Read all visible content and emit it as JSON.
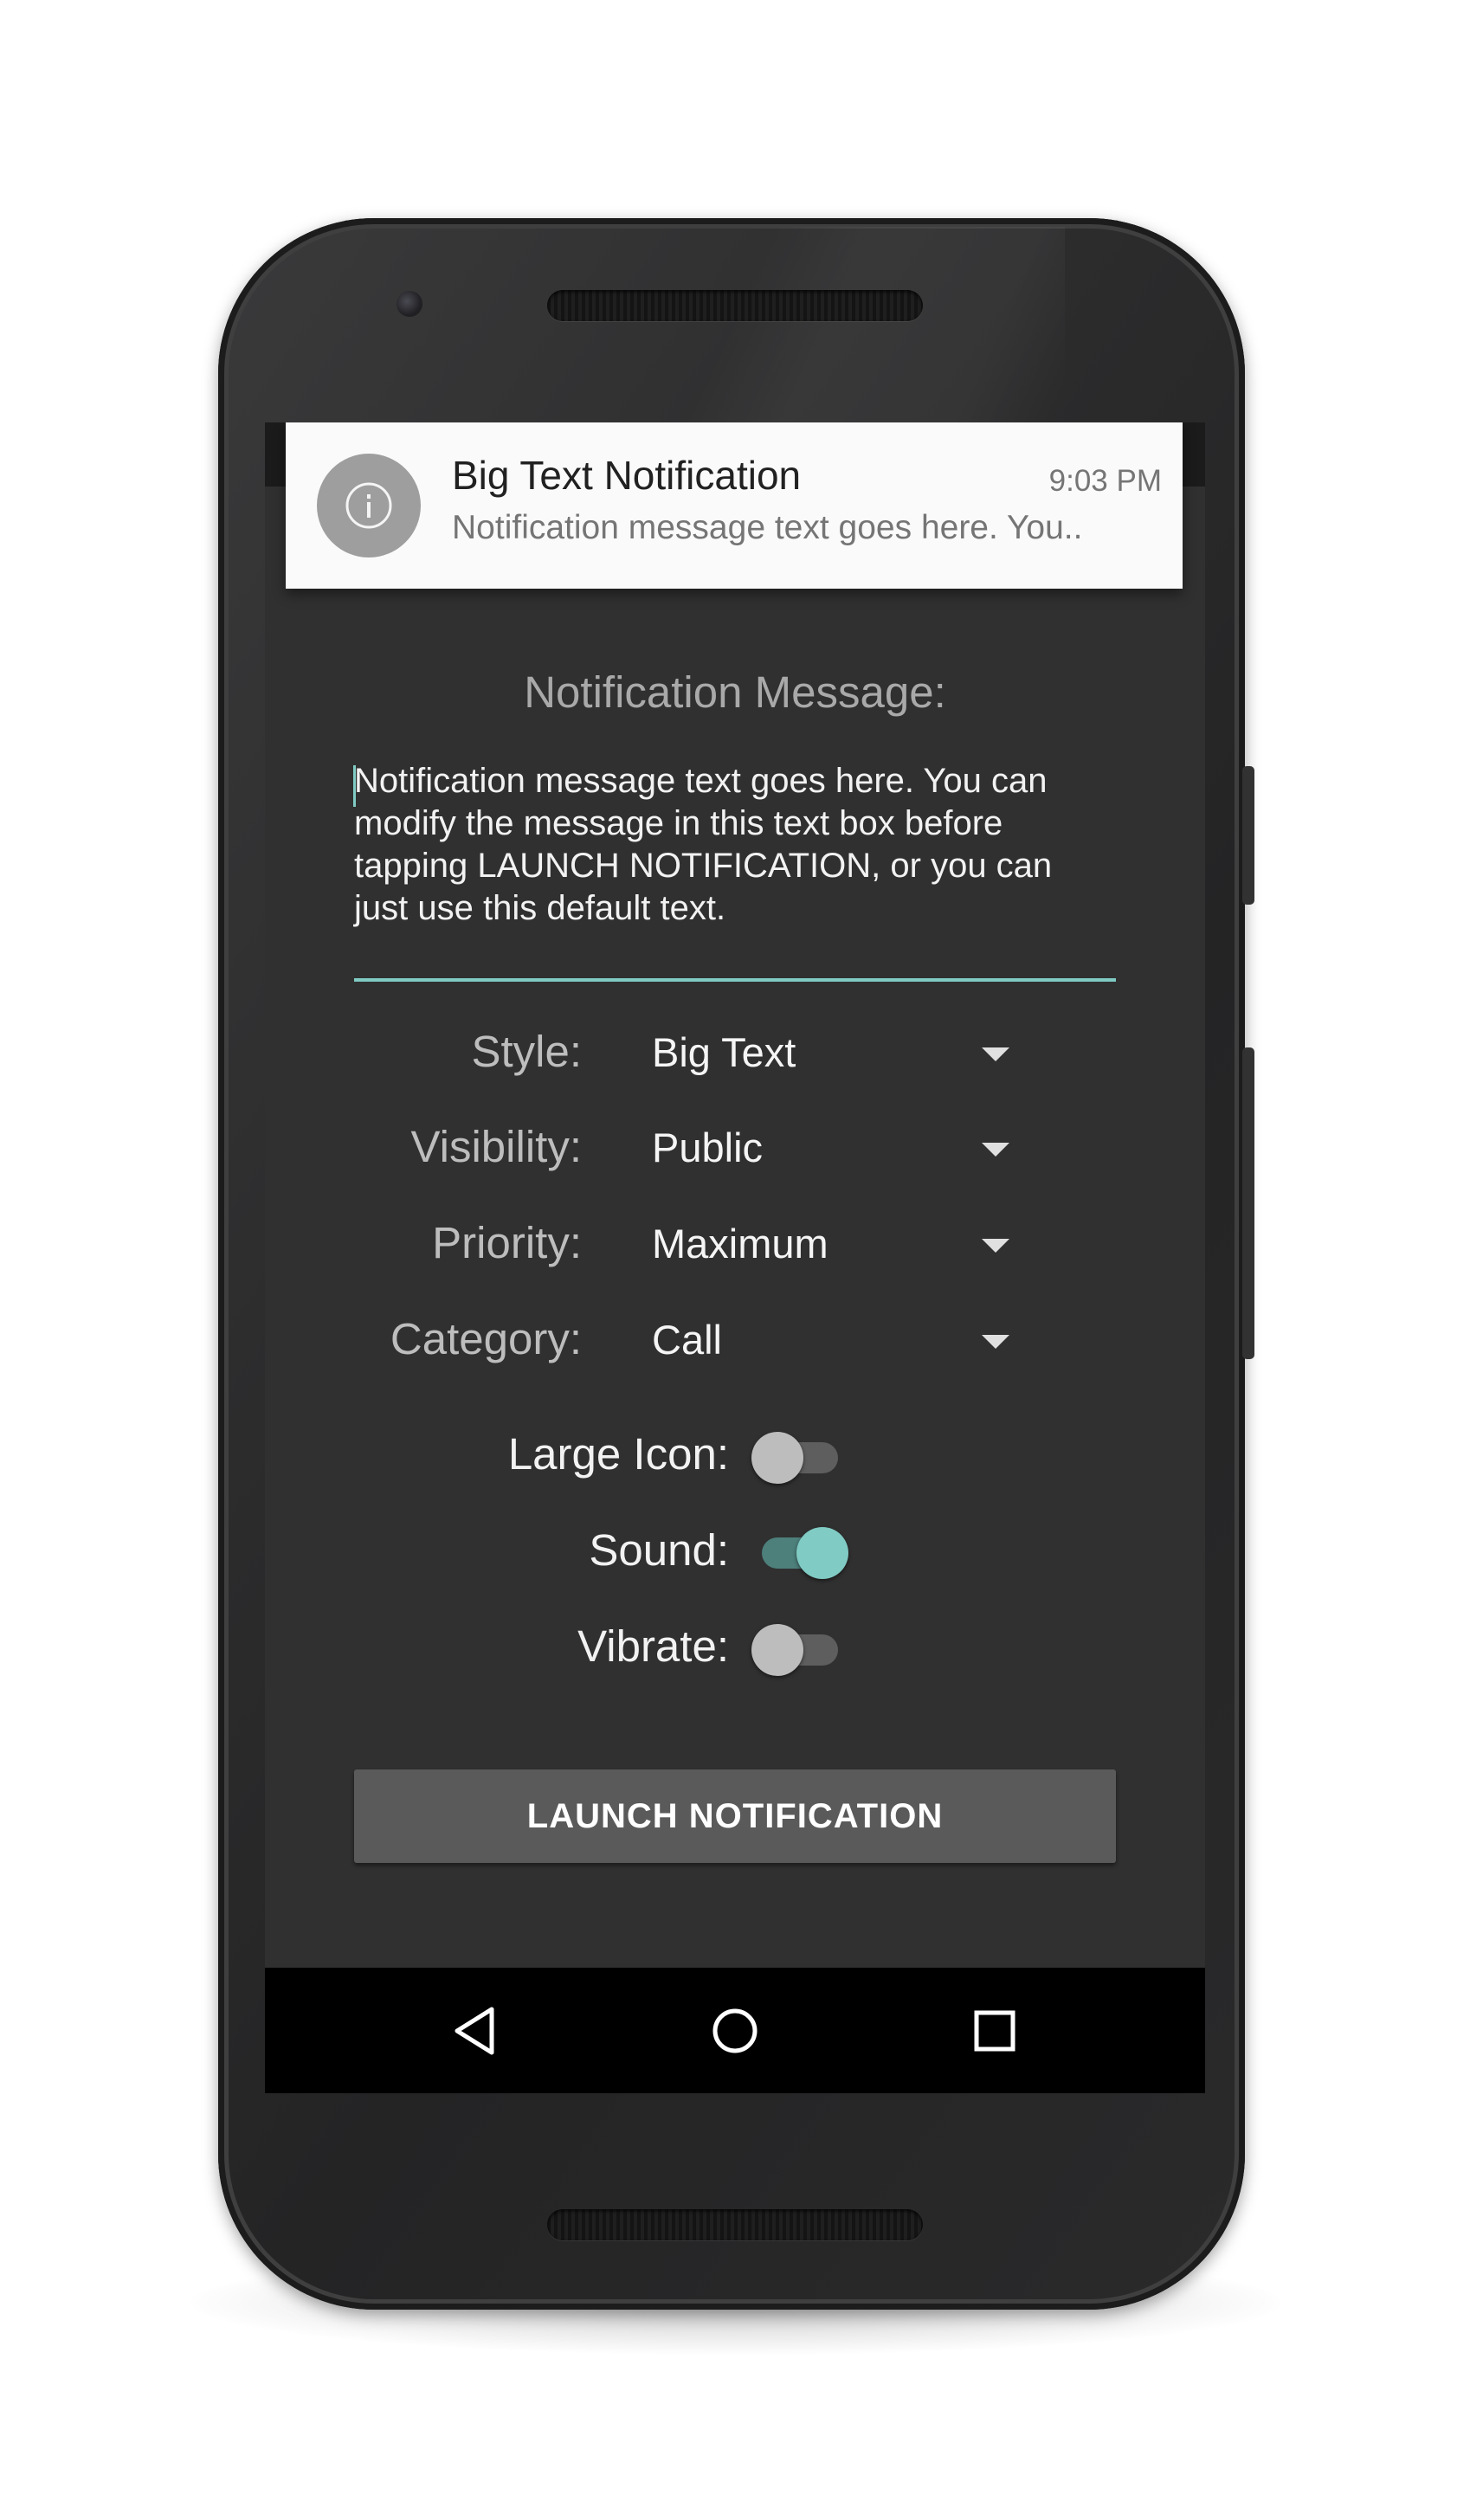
{
  "notification": {
    "icon": "info-icon",
    "title": "Big Text Notification",
    "time": "9:03 PM",
    "text": "Notification message text goes here. You.."
  },
  "message": {
    "heading": "Notification Message:",
    "text": "Notification message text goes here. You can\nmodify the message in this text box before\ntapping LAUNCH NOTIFICATION, or you can\njust use this default text."
  },
  "fields": {
    "style": {
      "label": "Style:",
      "value": "Big Text"
    },
    "visibility": {
      "label": "Visibility:",
      "value": "Public"
    },
    "priority": {
      "label": "Priority:",
      "value": "Maximum"
    },
    "category": {
      "label": "Category:",
      "value": "Call"
    }
  },
  "toggles": {
    "large_icon": {
      "label": "Large Icon:",
      "on": false
    },
    "sound": {
      "label": "Sound:",
      "on": true
    },
    "vibrate": {
      "label": "Vibrate:",
      "on": false
    }
  },
  "launch_button": "LAUNCH NOTIFICATION",
  "nav": {
    "back": "back-icon",
    "home": "home-icon",
    "recents": "recents-icon"
  },
  "colors": {
    "accent": "#80cbc4",
    "screen_bg": "#303030",
    "button_bg": "#5a5a5a"
  }
}
